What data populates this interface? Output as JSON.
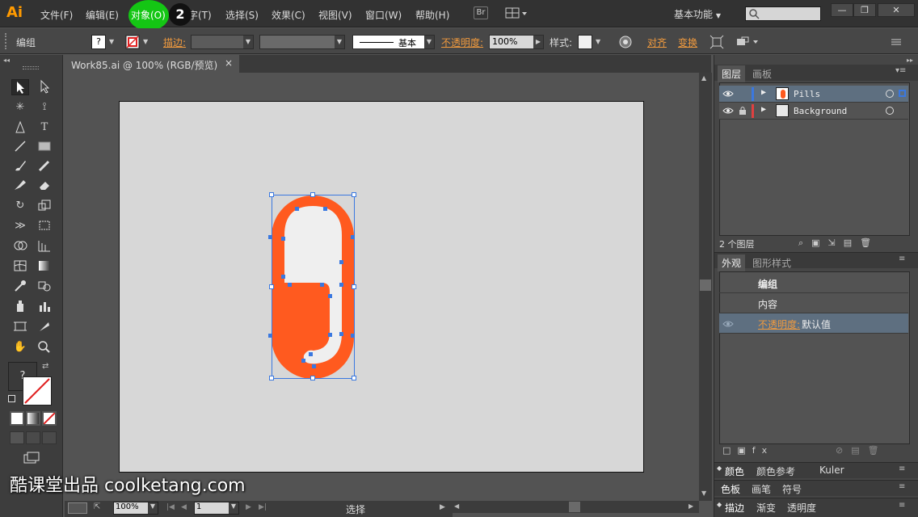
{
  "app": {
    "logo": "Ai"
  },
  "menus": [
    "文件(F)",
    "编辑(E)",
    "对象(O)",
    "文字(T)",
    "选择(S)",
    "效果(C)",
    "视图(V)",
    "窗口(W)",
    "帮助(H)"
  ],
  "step_badge": "2",
  "bridge_label": "Br",
  "workspace_label": "基本功能",
  "window_buttons": {
    "minimize": "—",
    "restore": "❐",
    "close": "✕"
  },
  "control_bar": {
    "selection_type": "编组",
    "fill_swatch": "?",
    "stroke_label": "描边:",
    "brush_label": "基本",
    "opacity_label": "不透明度:",
    "opacity_value": "100%",
    "style_label": "样式:",
    "align_label": "对齐",
    "transform_label": "变换"
  },
  "document": {
    "tab_title": "Work85.ai @ 100% (RGB/预览)",
    "close": "×"
  },
  "toolbox": {
    "fill_question": "?"
  },
  "layers_panel": {
    "tabs": [
      "图层",
      "画板"
    ],
    "layers": [
      {
        "name": "Pills",
        "color": "#3a78e0",
        "locked": false
      },
      {
        "name": "Background",
        "color": "#e04040",
        "locked": true
      }
    ],
    "count_label": "2 个图层"
  },
  "appearance_panel": {
    "tabs": [
      "外观",
      "图形样式"
    ],
    "group_title": "编组",
    "contents_label": "内容",
    "opacity_label": "不透明度:",
    "opacity_value": "默认值"
  },
  "collapsed_panels": [
    [
      "颜色",
      "颜色参考",
      "Kuler"
    ],
    [
      "色板",
      "画笔",
      "符号"
    ],
    [
      "描边",
      "渐变",
      "透明度"
    ]
  ],
  "status_bar": {
    "zoom": "100%",
    "page": "1",
    "mode": "选择"
  },
  "watermark": "酷课堂出品 coolketang.com",
  "colors": {
    "pill_orange": "#ff5a1f",
    "pill_light": "#efefef",
    "highlight_green": "#14c614",
    "selection_blue": "#3a78e0"
  }
}
